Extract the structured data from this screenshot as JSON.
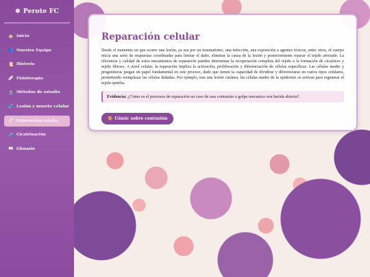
{
  "brand": {
    "icon": "❄",
    "title": "Perote FC"
  },
  "nav": [
    {
      "icon": "🏠",
      "label": "Inicio",
      "active": false
    },
    {
      "icon": "👥",
      "label": "Nuestro Equipo",
      "active": false
    },
    {
      "icon": "📜",
      "label": "Historia",
      "active": false
    },
    {
      "icon": "🩹",
      "label": "Fisioterapia",
      "active": false
    },
    {
      "icon": "🔬",
      "label": "Métodos de estudio",
      "active": false
    },
    {
      "icon": "🧬",
      "label": "Lesión y muerte celular",
      "active": false
    },
    {
      "icon": "🩹",
      "label": "Reparación celular",
      "active": true
    },
    {
      "icon": "🧪",
      "label": "Cicatrización",
      "active": false
    },
    {
      "icon": "📖",
      "label": "Glosario",
      "active": false
    }
  ],
  "card": {
    "title": "Reparación celular",
    "body": "Desde el momento en que ocurre una lesión, ya sea por un traumatismo, una infección, una exposición a agentes tóxicos, entre otros, el cuerpo inicia una serie de respuestas coordinadas para limitar el daño, eliminar la causa de la lesión y posteriormente reparar el tejido afectado. La eficiencia y calidad de estos mecanismos de reparación pueden determinar la recuperación completa del tejido o la formación de cicatrices y tejido fibroso. A nivel celular, la reparación implica la activación, proliferación y diferenciación de células específicas. Las células madre y progenitoras juegan un papel fundamental en este proceso, dado que tienen la capacidad de dividirse y diferenciarse en varios tipos celulares, permitiendo reemplazar las células dañadas. Por ejemplo, tras una lesión cutánea, las células madre de la epidermis se activan para regenerar el tejido epitelia.",
    "evidence_label": "Evidencia:",
    "evidence_text": " ¿Cómo es el procesos de reparación en caso de una contusión o golpe mecanico son herida abierta?.",
    "button_icon": "🎨",
    "button_label": "Cómic sobre contusión"
  },
  "colors": {
    "sidebar": "#8a4a9c",
    "active_item": "#e7b8d6",
    "accent": "#8a4a9c"
  }
}
